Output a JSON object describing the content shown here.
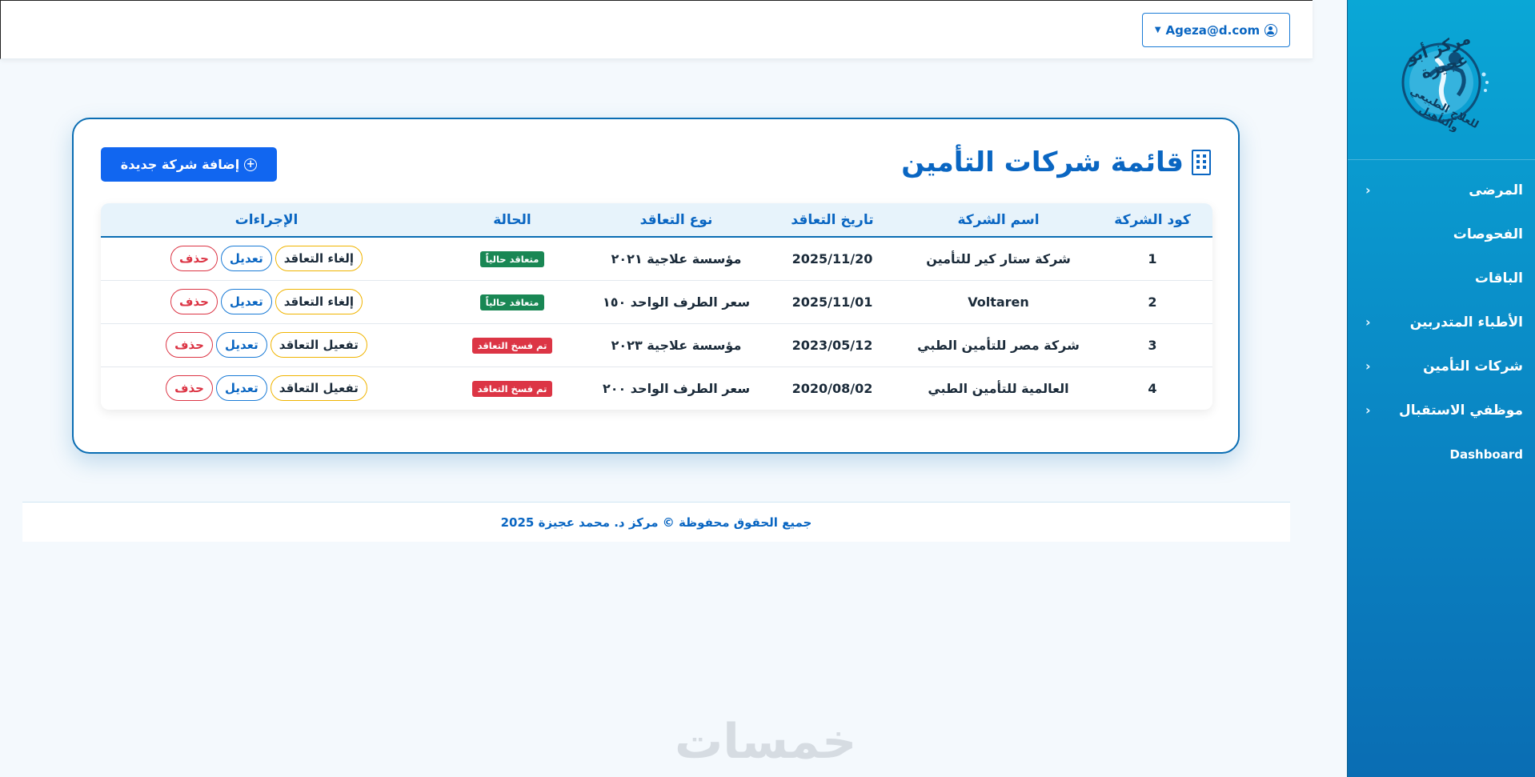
{
  "header": {
    "user_email": "Ageza@d.com"
  },
  "sidebar": {
    "logo_title": "مركز أبو عجيزة",
    "logo_subtitle": "للعلاج الطبيعي والتأهيل",
    "items": [
      {
        "label": "المرضى",
        "has_children": true
      },
      {
        "label": "الفحوصات",
        "has_children": false
      },
      {
        "label": "الباقات",
        "has_children": false
      },
      {
        "label": "الأطباء المتدربين",
        "has_children": true
      },
      {
        "label": "شركات التأمين",
        "has_children": true
      },
      {
        "label": "موظفي الاستقبال",
        "has_children": true
      },
      {
        "label": "Dashboard",
        "has_children": false
      }
    ]
  },
  "main": {
    "title": "قائمة شركات التأمين",
    "add_button": "إضافة شركة جديدة",
    "columns": [
      "كود الشركة",
      "اسم الشركة",
      "تاريخ التعاقد",
      "نوع التعاقد",
      "الحالة",
      "الإجراءات"
    ],
    "rows": [
      {
        "code": "1",
        "name": "شركة ستار كير للتأمين",
        "date": "2025/11/20",
        "type": "مؤسسة علاجية ٢٠٢١",
        "status": "متعاقد حالياً",
        "status_kind": "ok",
        "toggle": "إلغاء التعاقد",
        "edit": "تعديل",
        "delete": "حذف"
      },
      {
        "code": "2",
        "name": "Voltaren",
        "date": "2025/11/01",
        "type": "سعر الطرف الواحد ١٥٠",
        "status": "متعاقد حالياً",
        "status_kind": "ok",
        "toggle": "إلغاء التعاقد",
        "edit": "تعديل",
        "delete": "حذف"
      },
      {
        "code": "3",
        "name": "شركة مصر للتأمين الطبي",
        "date": "2023/05/12",
        "type": "مؤسسة علاجية ٢٠٢٣",
        "status": "تم فسخ التعاقد",
        "status_kind": "bad",
        "toggle": "تفعيل التعاقد",
        "edit": "تعديل",
        "delete": "حذف"
      },
      {
        "code": "4",
        "name": "العالمية للتأمين الطبي",
        "date": "2020/08/02",
        "type": "سعر الطرف الواحد ٢٠٠",
        "status": "تم فسخ التعاقد",
        "status_kind": "bad",
        "toggle": "تفعيل التعاقد",
        "edit": "تعديل",
        "delete": "حذف"
      }
    ]
  },
  "footer": {
    "text": "جميع الحقوق محفوظة © مركز د. محمد عجيزة 2025"
  },
  "watermark": "خمسات",
  "colors": {
    "primary": "#0a66c2",
    "sidebar": "#0a86c4",
    "success": "#198754",
    "danger": "#dc3545",
    "warning": "#f0b400",
    "add_button": "#1166f0"
  },
  "icons": {
    "user": "user-circle-icon",
    "caret": "caret-down-icon",
    "title": "building-icon",
    "add": "plus-circle-icon",
    "nav_chevron": "chevron-left-icon"
  }
}
